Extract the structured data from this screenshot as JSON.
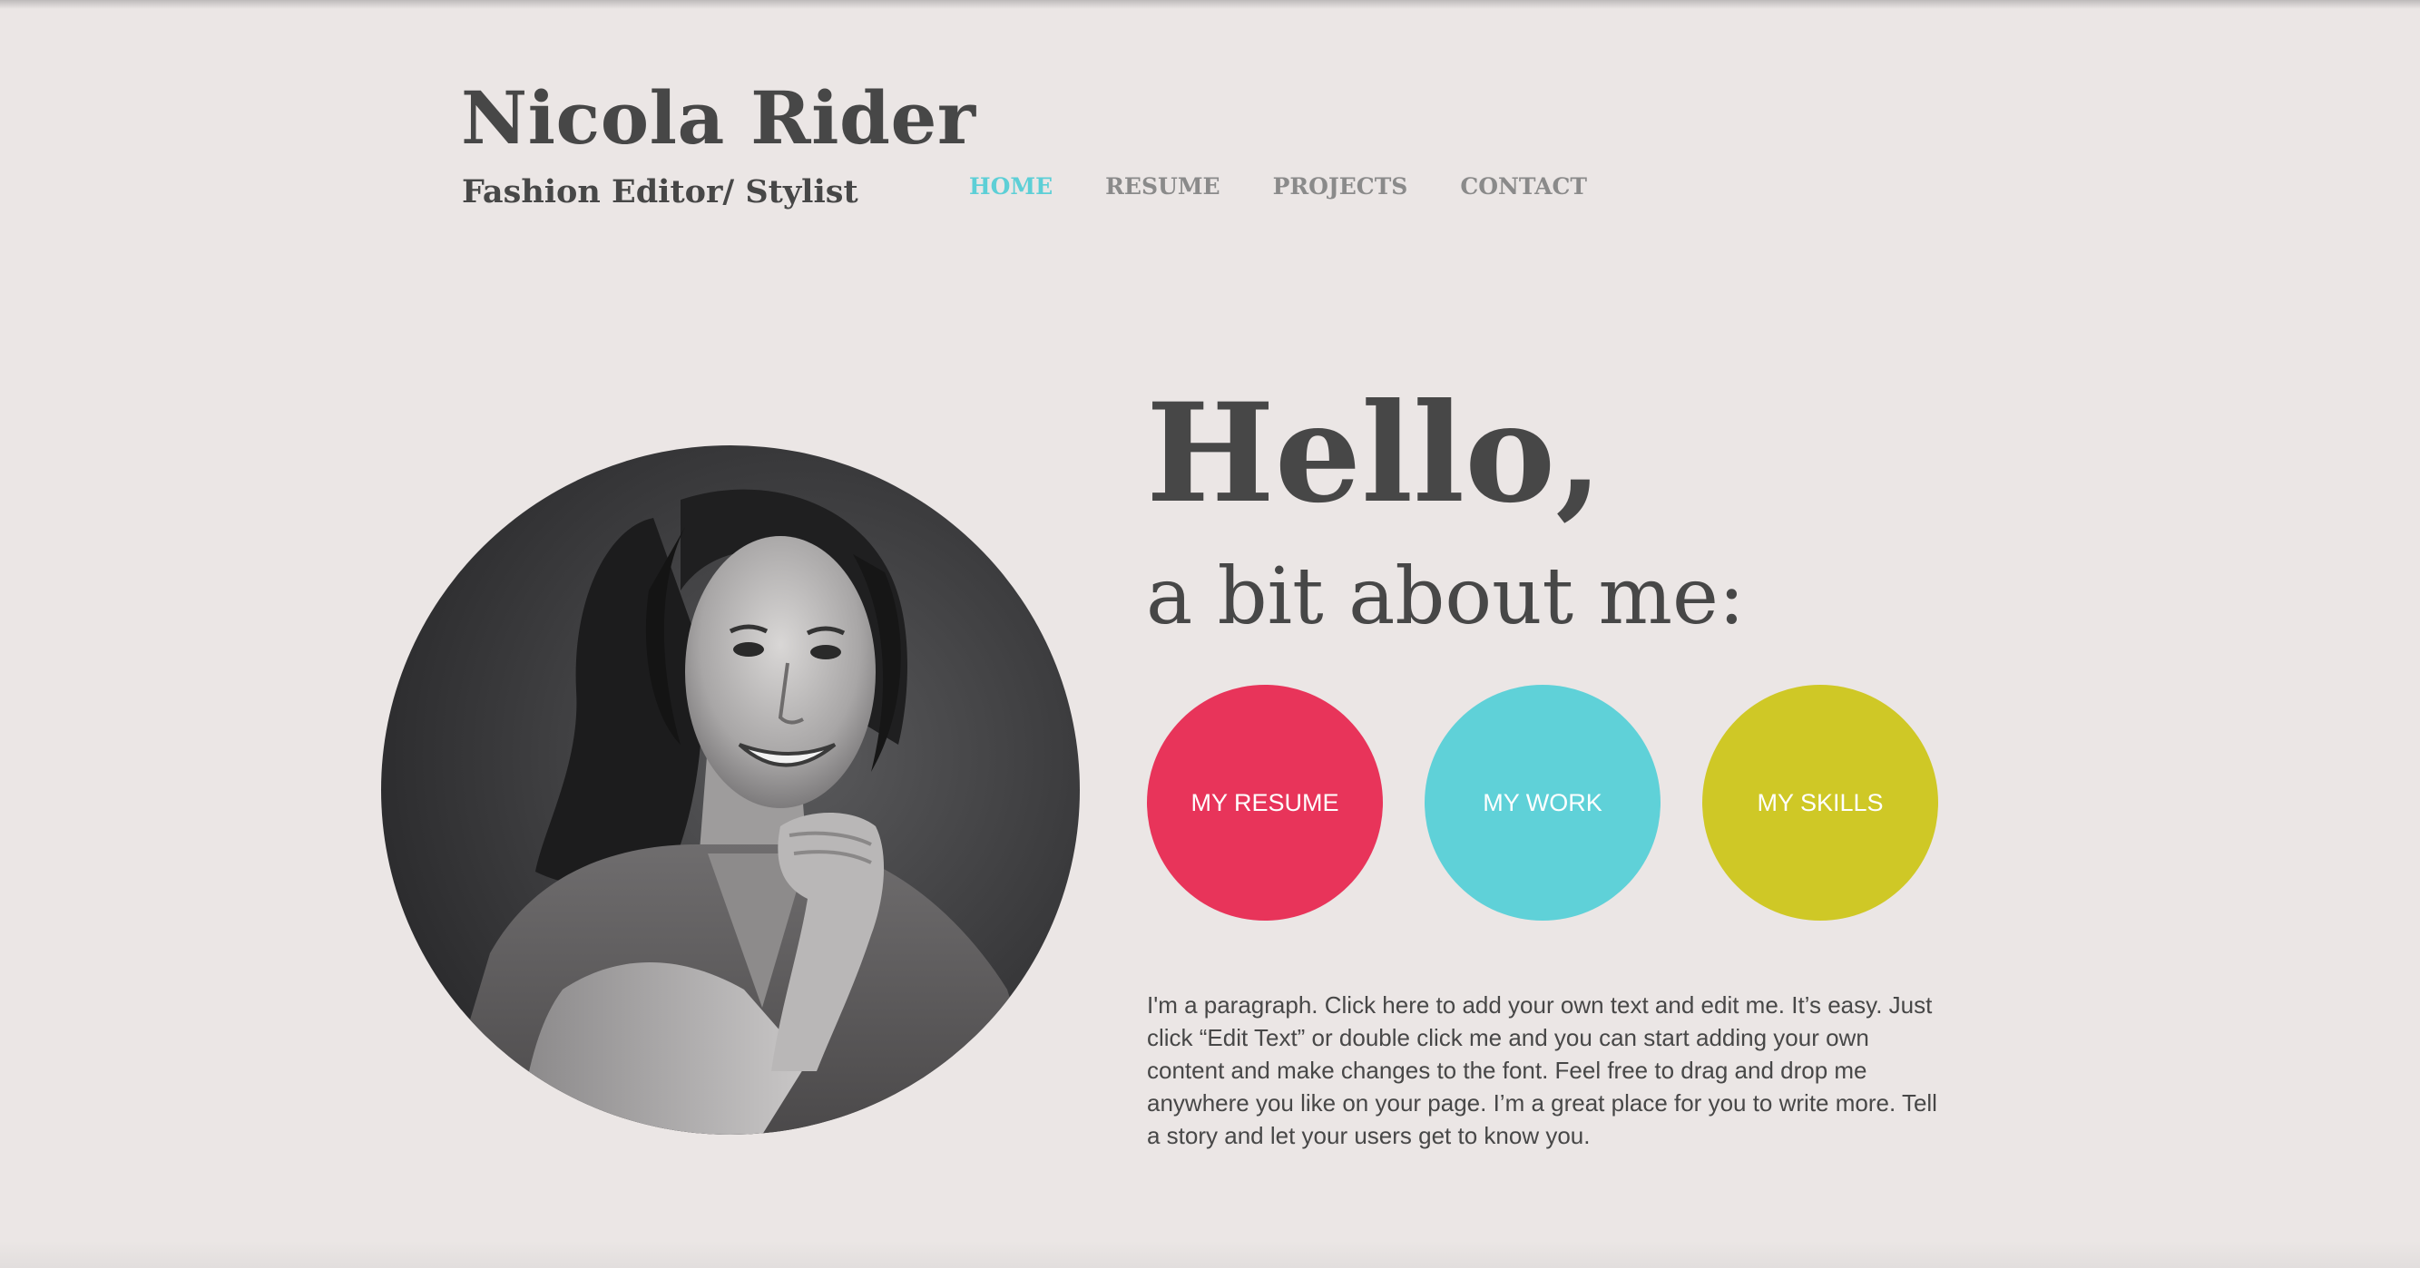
{
  "header": {
    "title": "Nicola Rider",
    "subtitle": "Fashion Editor/ Stylist"
  },
  "nav": {
    "items": [
      {
        "label": "HOME",
        "active": true
      },
      {
        "label": "RESUME",
        "active": false
      },
      {
        "label": "PROJECTS",
        "active": false
      },
      {
        "label": "CONTACT",
        "active": false
      }
    ]
  },
  "hero": {
    "greeting": "Hello,",
    "subheading": "a bit about me:",
    "photo_icon": "portrait-photo"
  },
  "buttons": [
    {
      "label": "MY RESUME",
      "color": "#e8345a"
    },
    {
      "label": "MY WORK",
      "color": "#5fd1d8"
    },
    {
      "label": "MY SKILLS",
      "color": "#cfc826"
    }
  ],
  "paragraph": "I'm a paragraph. Click here to add your own text and edit me. It’s easy. Just click “Edit Text” or double click me and you can start adding your own content and make changes to the font. Feel free to drag and drop me anywhere you like on your page. I’m a great place for you to write more. Tell a story and let your users get to know you.",
  "colors": {
    "background": "#ebe6e5",
    "text": "#474747",
    "nav_inactive": "#8a8a8a",
    "nav_active": "#5dcfd6"
  }
}
